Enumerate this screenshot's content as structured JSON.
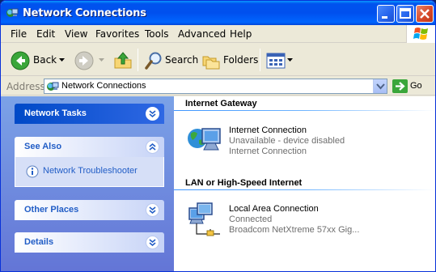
{
  "window": {
    "title": "Network Connections"
  },
  "menu": [
    "File",
    "Edit",
    "View",
    "Favorites",
    "Tools",
    "Advanced",
    "Help"
  ],
  "toolbar": {
    "back_label": "Back",
    "search_label": "Search",
    "folders_label": "Folders"
  },
  "address": {
    "label": "Address",
    "value": "Network Connections",
    "go_label": "Go"
  },
  "tasks": {
    "network_tasks": "Network Tasks",
    "see_also": "See Also",
    "troubleshooter": "Network Troubleshooter",
    "other_places": "Other Places",
    "details": "Details"
  },
  "groups": [
    {
      "title": "Internet Gateway",
      "items": [
        {
          "name": "Internet Connection",
          "line2": "Unavailable - device disabled",
          "line3": "Internet Connection"
        }
      ]
    },
    {
      "title": "LAN or High-Speed Internet",
      "items": [
        {
          "name": "Local Area Connection",
          "line2": "Connected",
          "line3": "Broadcom NetXtreme 57xx Gig..."
        }
      ]
    }
  ],
  "colors": {
    "titlebar": "#0053ee",
    "taskpane": "#6f8fe0",
    "link": "#215dc6"
  }
}
